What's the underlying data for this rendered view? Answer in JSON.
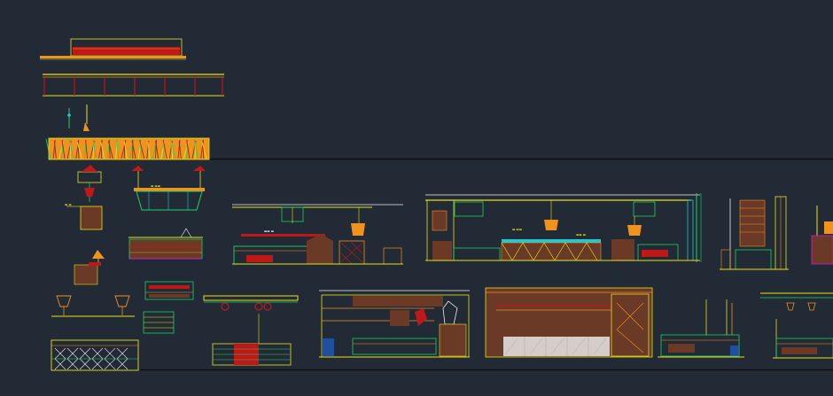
{
  "app": {
    "type": "cad-model-space-view"
  },
  "colors": {
    "background": "#222a35",
    "separator": "#0b0f14",
    "yellow": "#e8e11a",
    "orange": "#f0921e",
    "red": "#c01818",
    "green": "#20d060",
    "cyan": "#20c8d0",
    "brown": "#6a3a26",
    "white": "#f0f0f0",
    "magenta": "#d020d0"
  },
  "drawings": [
    {
      "id": "top-section-panel"
    },
    {
      "id": "top-rail-elevation"
    },
    {
      "id": "grass-pattern-strip"
    },
    {
      "id": "ceiling-lamp-detail"
    },
    {
      "id": "pendant-table-elevation"
    },
    {
      "id": "bar-counter-elevation"
    },
    {
      "id": "left-wall-elevation"
    },
    {
      "id": "main-wall-elevation"
    },
    {
      "id": "tall-cabinet-section"
    },
    {
      "id": "right-edge-fragment"
    },
    {
      "id": "table-lamp-detail"
    },
    {
      "id": "lamp-screen-elevation"
    },
    {
      "id": "stack-shelf-small"
    },
    {
      "id": "shelf-strip-small"
    },
    {
      "id": "pendant-counter-elevation"
    },
    {
      "id": "reception-elevation"
    },
    {
      "id": "window-wall-elevation"
    },
    {
      "id": "low-cabinet-elevation"
    },
    {
      "id": "right-counter-elevation"
    }
  ]
}
